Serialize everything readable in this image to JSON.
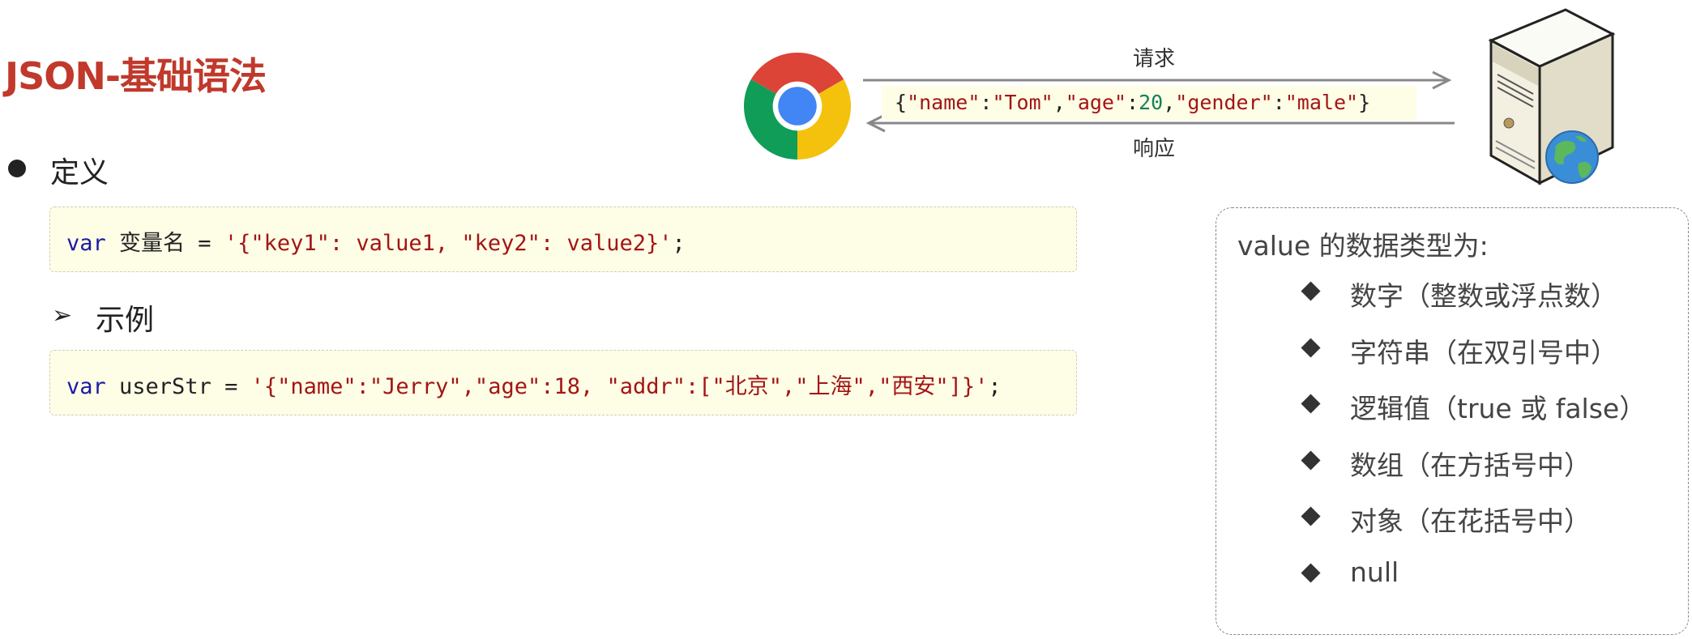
{
  "title": "JSON-基础语法",
  "definition": {
    "label": "定义",
    "code": {
      "keyword": "var",
      "rest_before_string": " 变量名 = ",
      "string": "'{\"key1\": value1, \"key2\": value2}'",
      "end": ";"
    }
  },
  "example": {
    "label": "示例",
    "code": {
      "keyword": "var",
      "rest_before_string": " userStr = ",
      "string": "'{\"name\":\"Jerry\",\"age\":18, \"addr\":[\"北京\",\"上海\",\"西安\"]}'",
      "end": ";"
    }
  },
  "diagram": {
    "request_label": "请求",
    "response_label": "响应",
    "payload": {
      "open": "{",
      "k1": "\"name\"",
      "c1": ":",
      "v1": "\"Tom\"",
      "s1": ",",
      "k2": "\"age\"",
      "c2": ":",
      "v2": "20",
      "s2": ",",
      "k3": "\"gender\"",
      "c3": ":",
      "v3": "\"male\"",
      "close": "}"
    },
    "client_icon": "chrome-browser-icon",
    "server_icon": "web-server-icon"
  },
  "value_types": {
    "heading": "value 的数据类型为:",
    "items": [
      "数字（整数或浮点数）",
      "字符串（在双引号中）",
      "逻辑值（true 或 false）",
      "数组（在方括号中）",
      "对象（在花括号中）",
      "null"
    ]
  },
  "colors": {
    "title": "#c0392b",
    "code_keyword": "#1a1aa6",
    "code_string": "#a31515",
    "code_number": "#16805a",
    "code_background": "#fefde6"
  }
}
